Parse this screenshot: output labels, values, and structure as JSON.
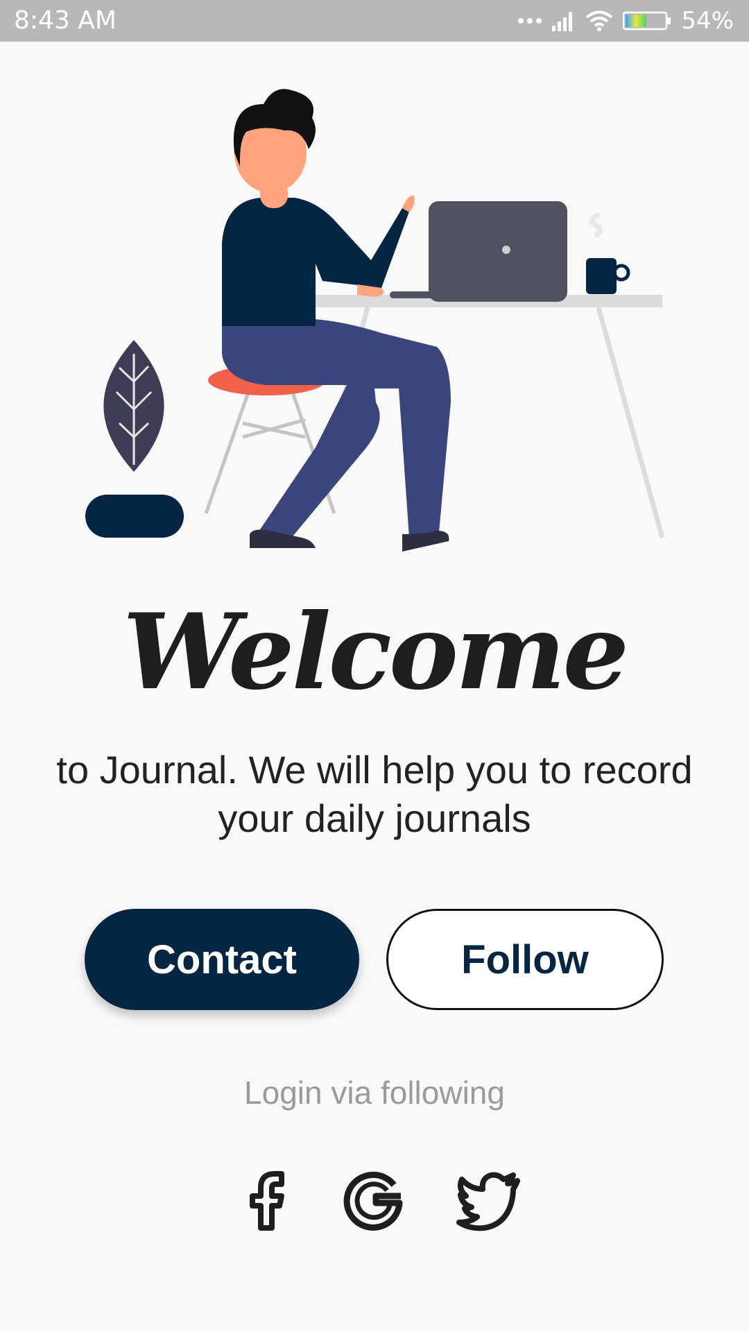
{
  "status_bar": {
    "time": "8:43  AM",
    "battery_percent": "54%",
    "battery_level": 0.54,
    "icons": [
      "more-dots-icon",
      "signal-icon",
      "wifi-icon",
      "battery-icon"
    ]
  },
  "illustration": {
    "name": "person-at-desk-illustration",
    "colors": {
      "navy": "#052643",
      "pants": "#3a467b",
      "skin": "#ffa47e",
      "laptop": "#505260",
      "desk": "#dcdcdc",
      "stool_seat": "#f2614a",
      "plant_leaf": "#3f3d56"
    }
  },
  "welcome": {
    "title": "Welcome",
    "subtitle": "to Journal. We will help you to record your daily journals"
  },
  "buttons": {
    "contact_label": "Contact",
    "follow_label": "Follow"
  },
  "login": {
    "label": "Login via following",
    "providers": [
      "facebook-icon",
      "google-icon",
      "twitter-icon"
    ]
  },
  "colors": {
    "primary": "#052643",
    "background": "#f9f9fa",
    "muted_text": "#9a9a9a",
    "status_bar": "#b8b8b8"
  }
}
